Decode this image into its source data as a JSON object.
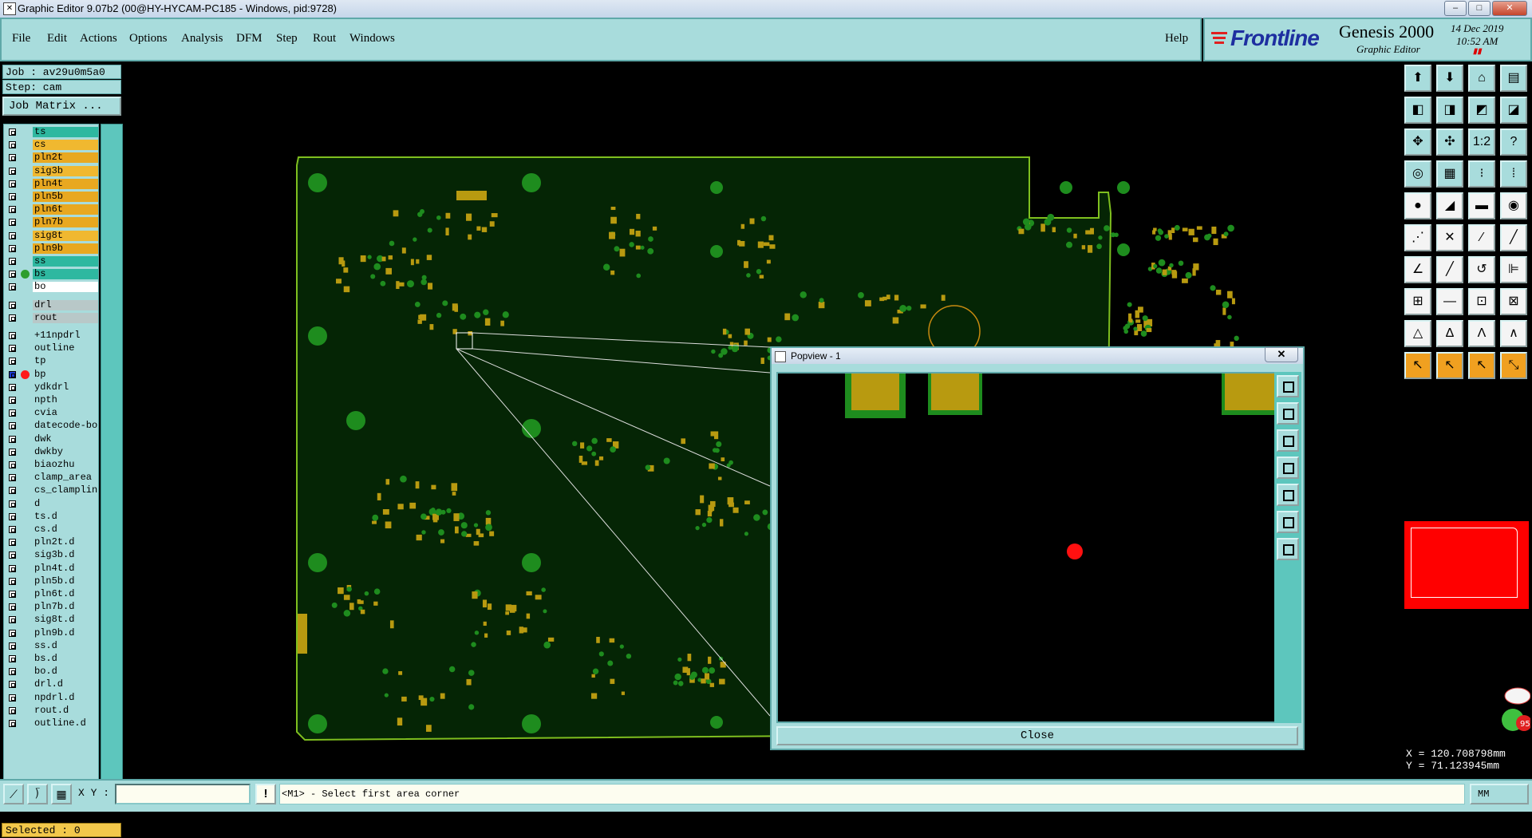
{
  "window": {
    "title": "Graphic Editor 9.07b2 (00@HY-HYCAM-PC185 - Windows, pid:9728)",
    "controls": [
      "–",
      "□",
      "✕"
    ]
  },
  "menu": {
    "items": [
      "File",
      "Edit",
      "Actions",
      "Options",
      "Analysis",
      "DFM",
      "Step",
      "Rout",
      "Windows"
    ],
    "help": "Help"
  },
  "brand": {
    "logo": "Frontline",
    "product": "Genesis 2000",
    "subtitle": "Graphic Editor",
    "date": "14 Dec 2019",
    "time": "10:52 AM"
  },
  "job": {
    "job_label": "Job : av29u0m5a0",
    "step_label": "Step: cam",
    "matrix_button": "Job Matrix ..."
  },
  "layers": [
    {
      "name": "ts",
      "color": "#2eb8a0"
    },
    {
      "name": "cs",
      "color": "#f0b830"
    },
    {
      "name": "pln2t",
      "color": "#e8a820"
    },
    {
      "name": "sig3b",
      "color": "#f0b830"
    },
    {
      "name": "pln4t",
      "color": "#e8a820"
    },
    {
      "name": "pln5b",
      "color": "#e8a820"
    },
    {
      "name": "pln6t",
      "color": "#e8a820"
    },
    {
      "name": "pln7b",
      "color": "#e8a820"
    },
    {
      "name": "sig8t",
      "color": "#f0b830"
    },
    {
      "name": "pln9b",
      "color": "#e8a820"
    },
    {
      "name": "ss",
      "color": "#2eb8a0"
    },
    {
      "name": "bs",
      "color": "#2eb8a0",
      "marker": "#2e9e2e"
    },
    {
      "name": "bo",
      "color": "#ffffff"
    },
    {
      "name": "drl",
      "color": "#b8c8c8"
    },
    {
      "name": "rout",
      "color": "#b8c8c8"
    },
    {
      "name": "+11npdrl",
      "color": "#a8dcdc"
    },
    {
      "name": "outline",
      "color": "#a8dcdc"
    },
    {
      "name": "tp",
      "color": "#a8dcdc"
    },
    {
      "name": "bp",
      "color": "#a8dcdc",
      "marker": "#ff1a1a",
      "active": true
    },
    {
      "name": "ydkdrl",
      "color": "#a8dcdc"
    },
    {
      "name": "npth",
      "color": "#a8dcdc"
    },
    {
      "name": "cvia",
      "color": "#a8dcdc"
    },
    {
      "name": "datecode-bo",
      "color": "#a8dcdc"
    },
    {
      "name": "dwk",
      "color": "#a8dcdc"
    },
    {
      "name": "dwkby",
      "color": "#a8dcdc"
    },
    {
      "name": "biaozhu",
      "color": "#a8dcdc"
    },
    {
      "name": "clamp_area",
      "color": "#a8dcdc"
    },
    {
      "name": "cs_clampline",
      "color": "#a8dcdc"
    },
    {
      "name": "d",
      "color": "#a8dcdc"
    },
    {
      "name": "ts.d",
      "color": "#a8dcdc"
    },
    {
      "name": "cs.d",
      "color": "#a8dcdc"
    },
    {
      "name": "pln2t.d",
      "color": "#a8dcdc"
    },
    {
      "name": "sig3b.d",
      "color": "#a8dcdc"
    },
    {
      "name": "pln4t.d",
      "color": "#a8dcdc"
    },
    {
      "name": "pln5b.d",
      "color": "#a8dcdc"
    },
    {
      "name": "pln6t.d",
      "color": "#a8dcdc"
    },
    {
      "name": "pln7b.d",
      "color": "#a8dcdc"
    },
    {
      "name": "sig8t.d",
      "color": "#a8dcdc"
    },
    {
      "name": "pln9b.d",
      "color": "#a8dcdc"
    },
    {
      "name": "ss.d",
      "color": "#a8dcdc"
    },
    {
      "name": "bs.d",
      "color": "#a8dcdc"
    },
    {
      "name": "bo.d",
      "color": "#a8dcdc"
    },
    {
      "name": "drl.d",
      "color": "#a8dcdc"
    },
    {
      "name": "npdrl.d",
      "color": "#a8dcdc"
    },
    {
      "name": "rout.d",
      "color": "#a8dcdc"
    },
    {
      "name": "outline.d",
      "color": "#a8dcdc"
    }
  ],
  "selected": "Selected : 0",
  "popview": {
    "title": "Popview - 1",
    "close_x": "✕",
    "close_button": "Close"
  },
  "coords": {
    "x": "X = 120.708798mm",
    "y": "Y = 71.123945mm"
  },
  "status": {
    "xy_label": "X Y :",
    "xy_value": "",
    "excl": "!",
    "prompt": "<M1> - Select first area corner",
    "units": "MM"
  },
  "ad_badge": "95",
  "colors": {
    "panel": "#a8dcdc",
    "board_fill": "#0a3a0a",
    "board_outline": "#7fbf1f",
    "pad_green": "#1e8c1e",
    "pad_gold": "#b89a10",
    "popview_dot": "#ff1010",
    "overview": "#ff0000"
  }
}
